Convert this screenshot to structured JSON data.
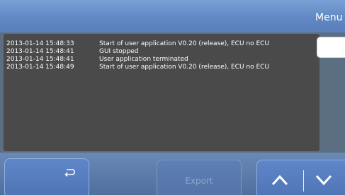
{
  "header": {
    "menu_label": "Menu"
  },
  "log": {
    "entries": [
      {
        "timestamp": "2013-01-14 15:48:33",
        "message": "Start of user application V0.20 (release), ECU no ECU"
      },
      {
        "timestamp": "2013-01-14 15:48:41",
        "message": "GUI stopped"
      },
      {
        "timestamp": "2013-01-14 15:48:41",
        "message": "User application terminated"
      },
      {
        "timestamp": "2013-01-14 15:48:49",
        "message": "Start of user application V0.20 (release), ECU no ECU"
      }
    ]
  },
  "footer": {
    "back_icon": "return-arrow-icon",
    "export_label": "Export",
    "up_icon": "chevron-up-icon",
    "down_icon": "chevron-down-icon"
  },
  "colors": {
    "header": "#6188c4",
    "log_background": "#4a4a4a",
    "button": "#5a80c2",
    "text": "#ffffff"
  }
}
